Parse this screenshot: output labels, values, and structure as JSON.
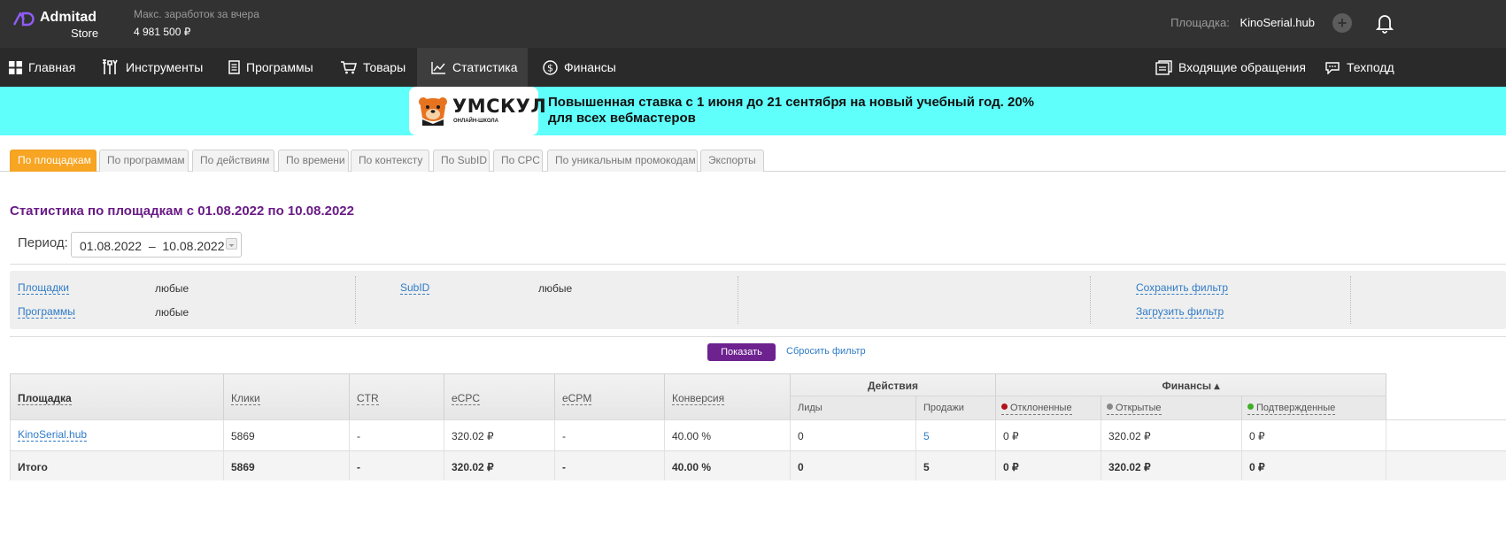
{
  "app": {
    "name": "Admitad",
    "sub": "Store",
    "earnings_label": "Макс. заработок за вчера",
    "earnings_value": "4 981 500 ₽",
    "site_label": "Площадка:",
    "site_value": "KinoSerial.hub",
    "plus_glyph": "+"
  },
  "nav": [
    {
      "label": "Главная",
      "icon": "grid-icon"
    },
    {
      "label": "Инструменты",
      "icon": "tools-icon"
    },
    {
      "label": "Программы",
      "icon": "document-icon"
    },
    {
      "label": "Товары",
      "icon": "cart-icon"
    },
    {
      "label": "Статистика",
      "icon": "chart-icon",
      "active": true
    },
    {
      "label": "Финансы",
      "icon": "dollar-icon"
    },
    {
      "label": "Входящие обращения",
      "icon": "inbox-icon"
    },
    {
      "label": "Техподд",
      "icon": "chat-icon"
    }
  ],
  "banner": {
    "brand": "УМСКУЛ",
    "brand_sub": "ОНЛАЙН-ШКОЛА",
    "line1": "Повышенная ставка с 1 июня до 21 сентября на новый учебный год. 20%",
    "line2": "для всех вебмастеров"
  },
  "tabs": [
    {
      "label": "По площадкам",
      "active": true
    },
    {
      "label": "По программам"
    },
    {
      "label": "По действиям"
    },
    {
      "label": "По времени"
    },
    {
      "label": "По контексту"
    },
    {
      "label": "По SubID"
    },
    {
      "label": "По CPC"
    },
    {
      "label": "По уникальным промокодам"
    },
    {
      "label": "Экспорты"
    }
  ],
  "page_title": "Статистика по площадкам с 01.08.2022 по 10.08.2022",
  "period": {
    "label": "Период:",
    "value": "01.08.2022  –  10.08.2022"
  },
  "filter": {
    "sites_label": "Площадки",
    "sites_value": "любые",
    "programs_label": "Программы",
    "programs_value": "любые",
    "subid_label": "SubID",
    "subid_value": "любые",
    "save_label": "Сохранить фильтр",
    "load_label": "Загрузить фильтр"
  },
  "actions": {
    "show_label": "Показать",
    "reset_label": "Сбросить фильтр"
  },
  "table": {
    "headers": {
      "site": "Площадка",
      "clicks": "Клики",
      "ctr": "CTR",
      "ecpc": "eCPC",
      "ecpm": "eCPM",
      "conversion": "Конверсия",
      "actions_group": "Действия",
      "leads": "Лиды",
      "sales": "Продажи",
      "finance_group": "Финансы ▴",
      "declined": "Отклоненные",
      "open": "Открытые",
      "confirmed": "Подтвержденные"
    },
    "status_colors": {
      "declined": "#b3121a",
      "open": "#888888",
      "confirmed": "#3fae29"
    },
    "rows": [
      {
        "site": "KinoSerial.hub",
        "clicks": "5869",
        "ctr": "-",
        "ecpc": "320.02 ₽",
        "ecpm": "-",
        "conversion": "40.00 %",
        "leads": "0",
        "sales": "5",
        "declined": "0 ₽",
        "open": "320.02 ₽",
        "confirmed": "0 ₽"
      }
    ],
    "total": {
      "site": "Итого",
      "clicks": "5869",
      "ctr": "-",
      "ecpc": "320.02 ₽",
      "ecpm": "-",
      "conversion": "40.00 %",
      "leads": "0",
      "sales": "5",
      "declined": "0 ₽",
      "open": "320.02 ₽",
      "confirmed": "0 ₽"
    }
  }
}
